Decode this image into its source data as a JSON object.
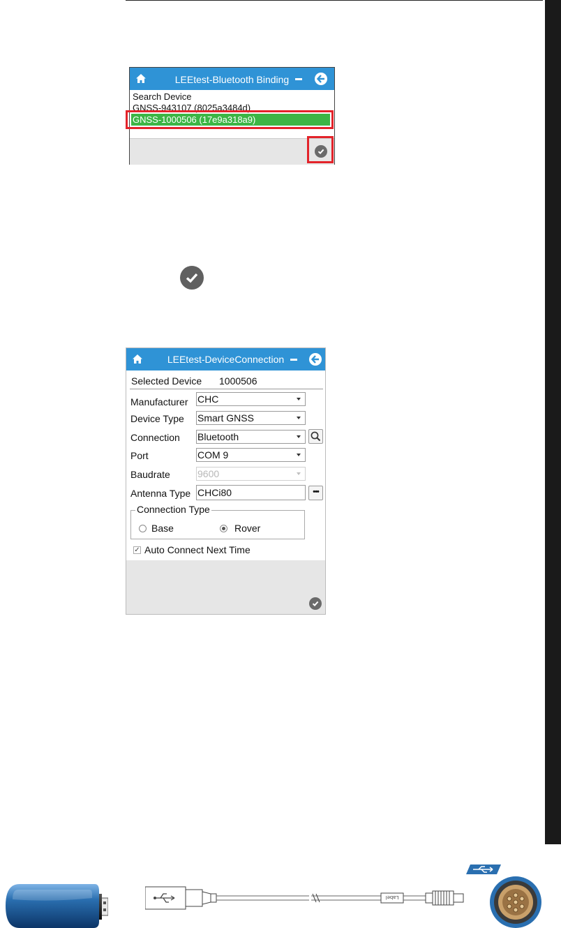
{
  "binding_window": {
    "title": "LEEtest-Bluetooth Binding",
    "items": [
      "Search Device",
      "GNSS-943107 (8025a3484d)"
    ],
    "selected_item": "GNSS-1000506 (17e9a318a9)"
  },
  "connection_window": {
    "title": "LEEtest-DeviceConnection",
    "selected_device_label": "Selected Device",
    "selected_device_value": "1000506",
    "manufacturer_label": "Manufacturer",
    "manufacturer_value": "CHC",
    "device_type_label": "Device Type",
    "device_type_value": "Smart GNSS",
    "connection_label": "Connection",
    "connection_value": "Bluetooth",
    "port_label": "Port",
    "port_value": "COM 9",
    "baudrate_label": "Baudrate",
    "baudrate_value": "9600",
    "antenna_label": "Antenna Type",
    "antenna_value": "CHCi80",
    "antenna_more": "•••",
    "connection_type_label": "Connection Type",
    "base_label": "Base",
    "rover_label": "Rover",
    "rover_selected": true,
    "auto_connect_label": "Auto Connect Next Time",
    "auto_connect_checked": true
  },
  "cable_label": "Label",
  "colors": {
    "titlebar": "#2f93d6",
    "selected_row": "#3cb545",
    "highlight": "#e3232a",
    "footer": "#e6e6e6",
    "usb_blue": "#2a6fb0"
  },
  "icons": [
    "home-icon",
    "minimize-icon",
    "back-arrow-icon",
    "check-icon",
    "search-icon",
    "more-icon",
    "usb-icon"
  ]
}
